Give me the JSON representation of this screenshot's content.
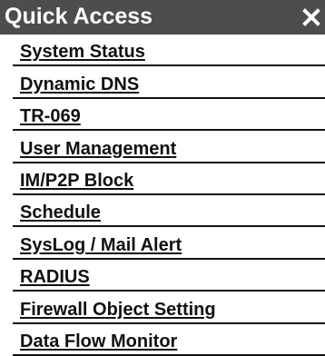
{
  "header": {
    "title": "Quick Access",
    "close_icon": "close-icon",
    "background": "#4d4d4d"
  },
  "menu": {
    "items": [
      {
        "label": "System Status"
      },
      {
        "label": "Dynamic DNS"
      },
      {
        "label": "TR-069"
      },
      {
        "label": "User Management"
      },
      {
        "label": "IM/P2P Block"
      },
      {
        "label": "Schedule"
      },
      {
        "label": "SysLog / Mail Alert"
      },
      {
        "label": "RADIUS"
      },
      {
        "label": "Firewall Object Setting"
      },
      {
        "label": "Data Flow Monitor"
      }
    ]
  }
}
